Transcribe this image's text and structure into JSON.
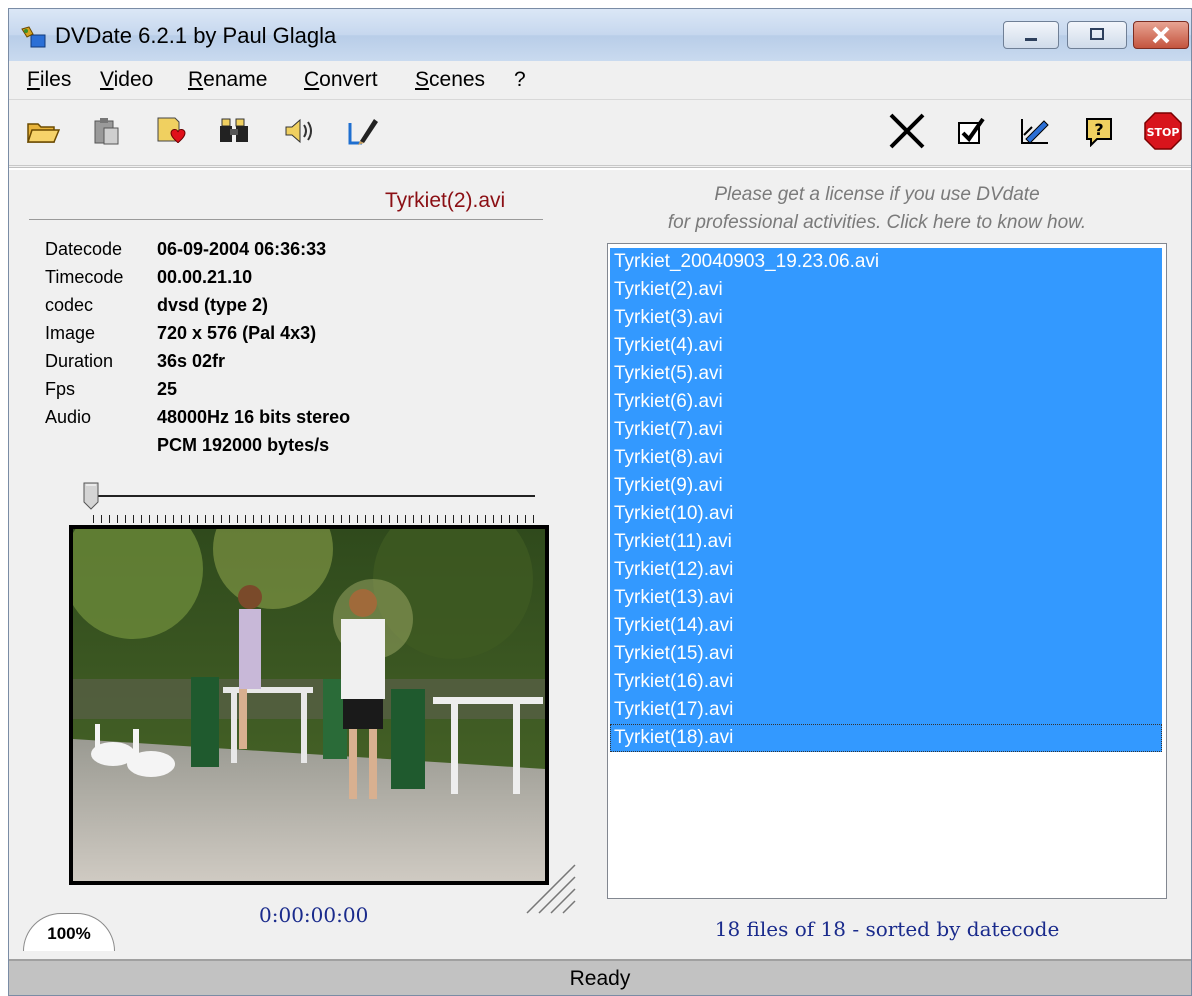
{
  "window": {
    "title": "DVDate 6.2.1 by Paul Glagla"
  },
  "menu": [
    "Files",
    "Video",
    "Rename",
    "Convert",
    "Scenes",
    "?"
  ],
  "toolbar_left": [
    "open-folder-icon",
    "paste-icon",
    "favorite-icon",
    "binoculars-icon",
    "speaker-icon",
    "edit-pen-icon"
  ],
  "toolbar_right": [
    "close-x-icon",
    "checkbox-icon",
    "edit-chart-icon",
    "help-icon",
    "stop-icon"
  ],
  "file": {
    "name": "Tyrkiet(2).avi",
    "info": [
      {
        "label": "Datecode",
        "value": "06-09-2004 06:36:33"
      },
      {
        "label": "Timecode",
        "value": "00.00.21.10"
      },
      {
        "label": "codec",
        "value": "dvsd (type 2)"
      },
      {
        "label": "Image",
        "value": "720 x 576 (Pal 4x3)"
      },
      {
        "label": "Duration",
        "value": "36s 02fr"
      },
      {
        "label": "Fps",
        "value": "25"
      },
      {
        "label": "Audio",
        "value": "48000Hz 16 bits  stereo"
      },
      {
        "label": "",
        "value": "PCM 192000 bytes/s"
      }
    ]
  },
  "player": {
    "timecode": "0:00:00:00",
    "zoom": "100%",
    "position": 0
  },
  "license": {
    "line1": "Please get a license if you use DVdate",
    "line2": "for professional activities. Click here to know how."
  },
  "files": [
    "Tyrkiet_20040903_19.23.06.avi",
    "Tyrkiet(2).avi",
    "Tyrkiet(3).avi",
    "Tyrkiet(4).avi",
    "Tyrkiet(5).avi",
    "Tyrkiet(6).avi",
    "Tyrkiet(7).avi",
    "Tyrkiet(8).avi",
    "Tyrkiet(9).avi",
    "Tyrkiet(10).avi",
    "Tyrkiet(11).avi",
    "Tyrkiet(12).avi",
    "Tyrkiet(13).avi",
    "Tyrkiet(14).avi",
    "Tyrkiet(15).avi",
    "Tyrkiet(16).avi",
    "Tyrkiet(17).avi",
    "Tyrkiet(18).avi"
  ],
  "list_status": "18 files of 18 - sorted by datecode",
  "status": "Ready",
  "colors": {
    "selection": "#3399ff",
    "filename": "#8b0f14",
    "accent_text": "#1a2b8c"
  }
}
